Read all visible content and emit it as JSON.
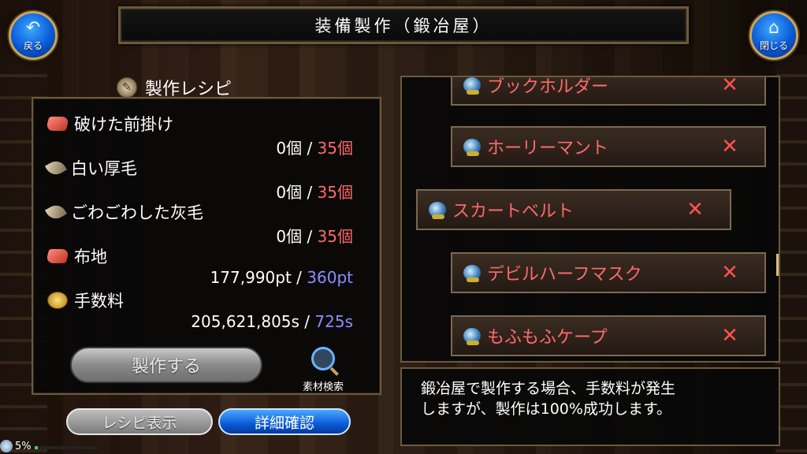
{
  "header": {
    "title": "装備製作（鍛冶屋）",
    "back_label": "戻る",
    "back_icon": "back-arrow-icon",
    "close_label": "閉じる",
    "close_icon": "home-icon"
  },
  "recipe": {
    "title": "製作レシピ",
    "materials": [
      {
        "name": "破けた前掛け",
        "have": "0個",
        "sep": " / ",
        "need": "35個",
        "need_color": "#ff6a6a",
        "icon": "cloth-icon"
      },
      {
        "name": "白い厚毛",
        "have": "0個",
        "sep": " / ",
        "need": "35個",
        "need_color": "#ff6a6a",
        "icon": "fur-icon"
      },
      {
        "name": "ごわごわした灰毛",
        "have": "0個",
        "sep": " / ",
        "need": "35個",
        "need_color": "#ff6a6a",
        "icon": "fur-icon"
      },
      {
        "name": "布地",
        "have": "177,990pt",
        "sep": " / ",
        "need": "360pt",
        "need_color": "#8c8cff",
        "icon": "cloth-icon"
      },
      {
        "name": "手数料",
        "have": "205,621,805s",
        "sep": " / ",
        "need": "725s",
        "need_color": "#8c8cff",
        "icon": "coin-icon"
      }
    ],
    "craft_button": "製作する",
    "search_label": "素材検索",
    "recipe_view_button": "レシピ表示",
    "detail_button": "詳細確認"
  },
  "status": {
    "percent": "5%",
    "fill": 0.05
  },
  "list": {
    "items": [
      {
        "name": "ブックホルダー",
        "remove": "✕",
        "selected": false
      },
      {
        "name": "ホーリーマント",
        "remove": "✕",
        "selected": false
      },
      {
        "name": "スカートベルト",
        "remove": "✕",
        "selected": true
      },
      {
        "name": "デビルハーフマスク",
        "remove": "✕",
        "selected": false
      },
      {
        "name": "もふもふケープ",
        "remove": "✕",
        "selected": false
      }
    ]
  },
  "message": {
    "line1": "鍛冶屋で製作する場合、手数料が発生",
    "line2": "しますが、製作は100%成功します。"
  }
}
